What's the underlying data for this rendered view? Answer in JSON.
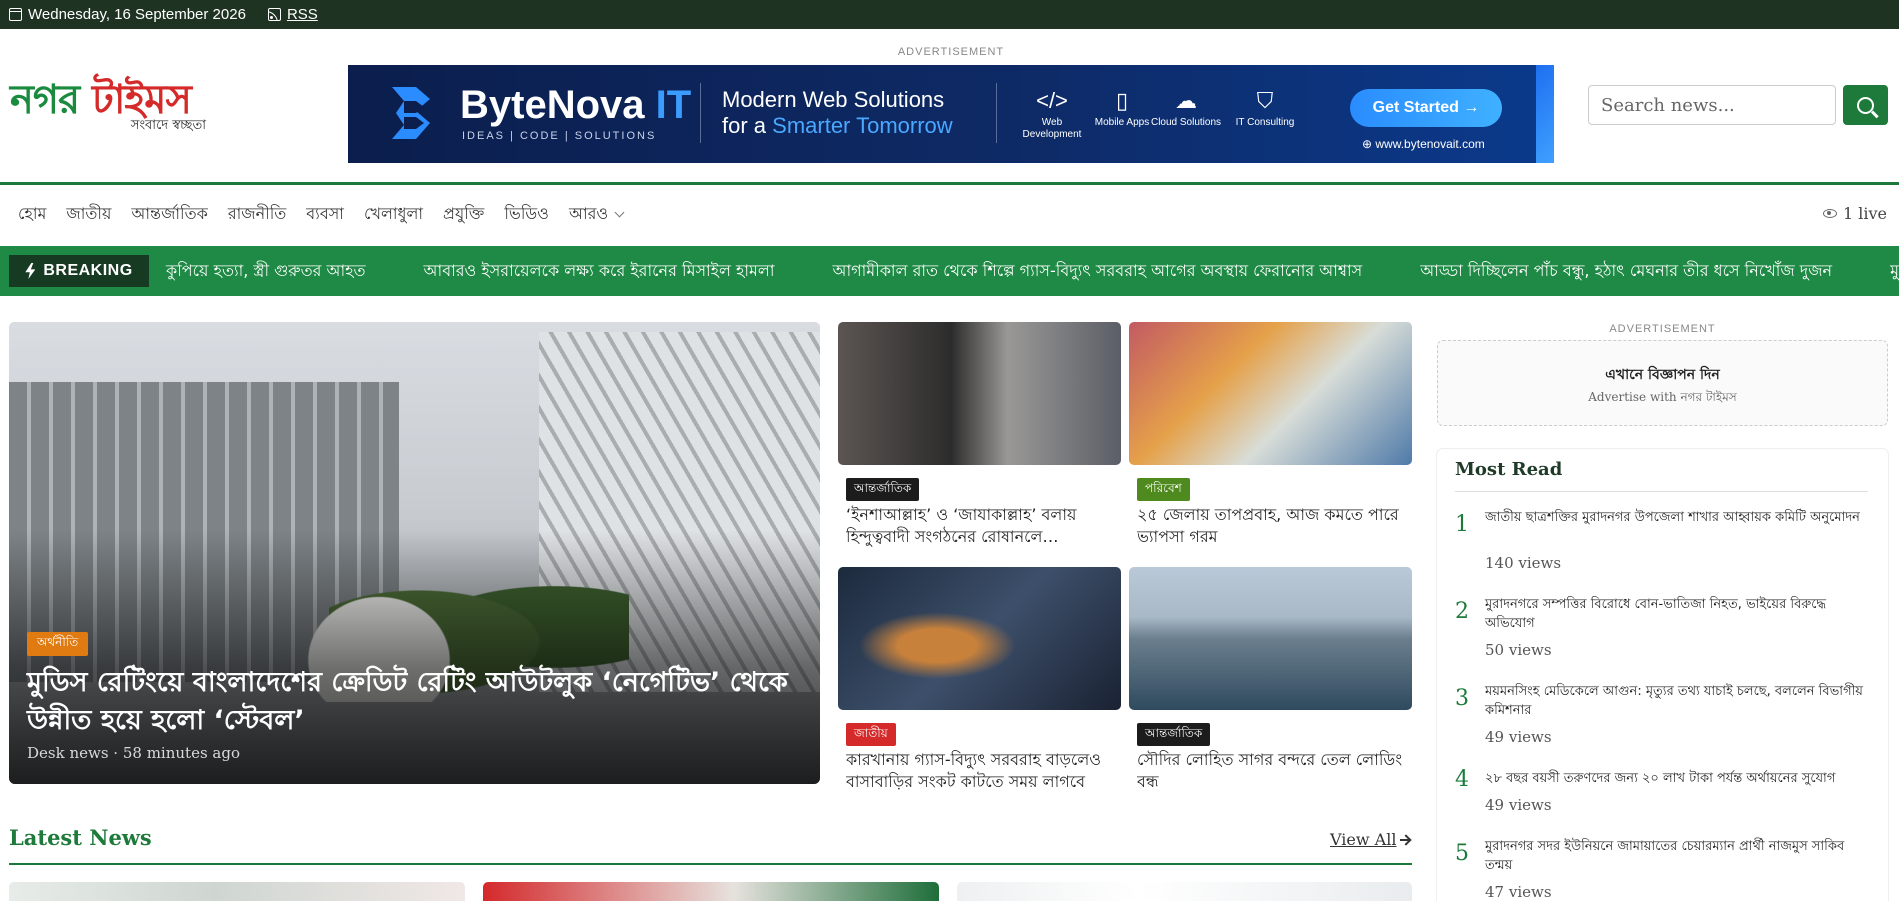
{
  "topbar": {
    "date": "Wednesday, 16 September 2026",
    "rss": "RSS"
  },
  "logo": {
    "part1": "নগর ",
    "part2": "টাইমস",
    "tagline": "সংবাদে স্বচ্ছতা"
  },
  "header_ad": {
    "label": "ADVERTISEMENT",
    "brand_a": "ByteNova",
    "brand_b": " IT",
    "brand_sub": "IDEAS  |  CODE  |  SOLUTIONS",
    "headline1": "Modern Web Solutions",
    "headline2a": "for a ",
    "headline2b": "Smarter Tomorrow",
    "services": [
      {
        "glyph": "</>",
        "label": "Web Development"
      },
      {
        "glyph": "▯",
        "label": "Mobile Apps"
      },
      {
        "glyph": "☁",
        "label": "Cloud Solutions"
      },
      {
        "glyph": "⛉",
        "label": "IT Consulting"
      }
    ],
    "cta": "Get Started →",
    "url": "⊕ www.bytenovait.com"
  },
  "search": {
    "placeholder": "Search news..."
  },
  "nav": {
    "items": [
      "হোম",
      "জাতীয়",
      "আন্তর্জাতিক",
      "রাজনীতি",
      "ব্যবসা",
      "খেলাধুলা",
      "প্রযুক্তি",
      "ভিডিও",
      "আরও"
    ],
    "live": "1 live"
  },
  "breaking": {
    "label": "BREAKING",
    "items": [
      "কুপিয়ে হত্যা, স্ত্রী গুরুতর আহত",
      "আবারও ইসরায়েলকে লক্ষ্য করে ইরানের মিসাইল হামলা",
      "আগামীকাল রাত থেকে শিল্পে গ্যাস-বিদ্যুৎ সরবরাহ আগের অবস্থায় ফেরানোর আশ্বাস",
      "আড্ডা দিচ্ছিলেন পাঁচ বন্ধু, হঠাৎ মেঘনার তীর ধসে নিখোঁজ দুজন",
      "মুরাদনগ"
    ]
  },
  "hero": {
    "category": "অর্থনীতি",
    "title": "মুডিস রেটিংয়ে বাংলাদেশের ক্রেডিট রেটিং আউটলুক ‘নেগেটিভ’ থেকে উন্নীত হয়ে হলো ‘স্টেবল’",
    "meta": "Desk news · 58 minutes ago"
  },
  "cards": [
    {
      "category": "আন্তর্জাতিক",
      "cat_color": "#1c1c1c",
      "title": "‘ইনশাআল্লাহ’ ও ‘জাযাকাল্লাহ’ বলায় হিন্দুত্ববাদী সংগঠনের রোষানলে পশ্চিমবঙ্গের নারী পুলিশ কর্মকর্তা"
    },
    {
      "category": "পরিবেশ",
      "cat_color": "#4e8a1e",
      "title": "২৫ জেলায় তাপপ্রবাহ, আজ কমতে পারে ভ্যাপসা গরম"
    },
    {
      "category": "জাতীয়",
      "cat_color": "#d42a2a",
      "title": "কারখানায় গ্যাস-বিদ্যুৎ সরবরাহ বাড়লেও বাসাবাড়ির সংকট কাটতে সময় লাগবে"
    },
    {
      "category": "আন্তর্জাতিক",
      "cat_color": "#1c1c1c",
      "title": "সৌদির লোহিত সাগর বন্দরে তেল লোডিং বন্ধ"
    }
  ],
  "sidebar_ad": {
    "label": "ADVERTISEMENT",
    "title": "এখানে বিজ্ঞাপন দিন",
    "subtitle": "Advertise with নগর টাইমস"
  },
  "most_read": {
    "title": "Most Read",
    "items": [
      {
        "rank": "1",
        "title": "জাতীয় ছাত্রশক্তির মুরাদনগর উপজেলা শাখার আহ্বায়ক কমিটি অনুমোদন",
        "views": "140 views"
      },
      {
        "rank": "2",
        "title": "মুরাদনগরে সম্পত্তির বিরোধে বোন-ভাতিজা নিহত, ভাইয়ের বিরুদ্ধে অভিযোগ",
        "views": "50 views"
      },
      {
        "rank": "3",
        "title": "ময়মনসিংহ মেডিকেলে আগুন: মৃত্যুর তথ্য যাচাই চলছে, বললেন বিভাগীয় কমিশনার",
        "views": "49 views"
      },
      {
        "rank": "4",
        "title": "২৮ বছর বয়সী তরুণদের জন্য ২০ লাখ টাকা পর্যন্ত অর্থায়নের সুযোগ",
        "views": "49 views"
      },
      {
        "rank": "5",
        "title": "মুরাদনগর সদর ইউনিয়নে জামায়াতের চেয়ারম্যান প্রার্থী নাজমুস সাকিব তন্ময়",
        "views": "47 views"
      }
    ]
  },
  "latest": {
    "title": "Latest News",
    "view_all": "View All"
  },
  "colors": {
    "brand_green": "#1d7a3a",
    "topbar": "#1f3322",
    "breaking_bg": "#1f8a45",
    "accent_red": "#d42a2a"
  }
}
